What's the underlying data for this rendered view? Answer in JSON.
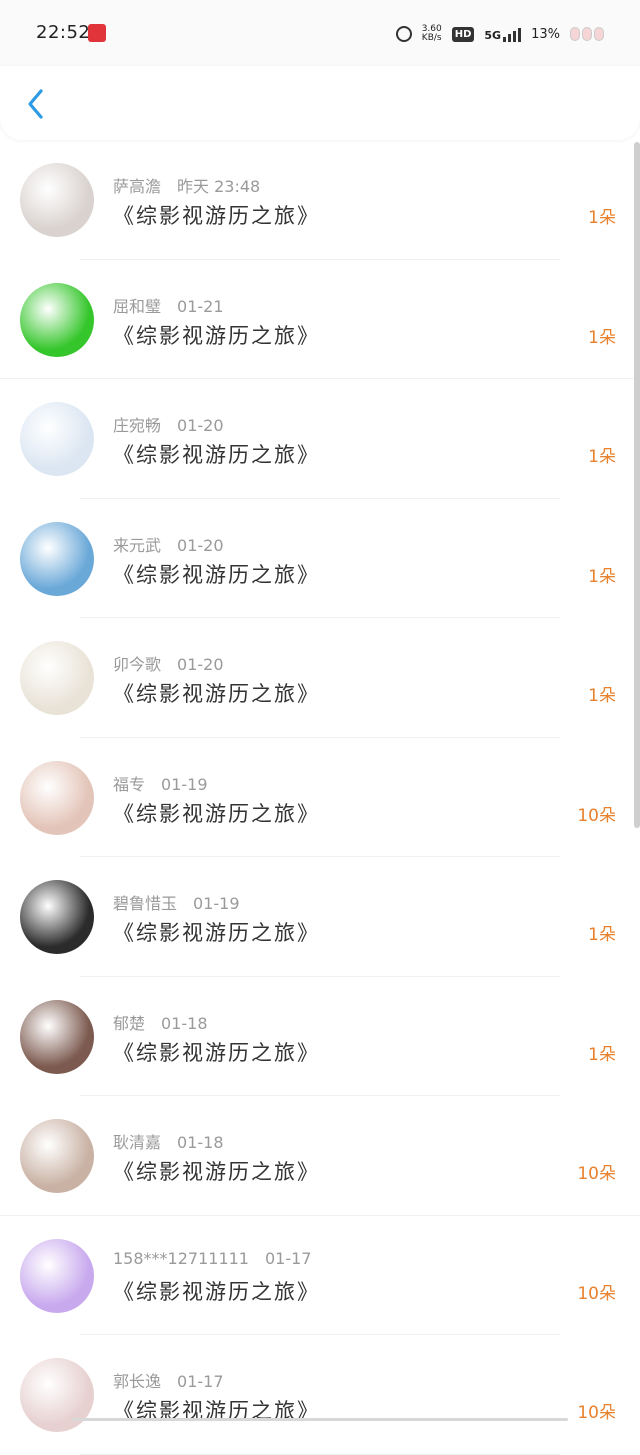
{
  "status_bar": {
    "time": "22:52",
    "net_speed_value": "3.60",
    "net_speed_unit": "KB/s",
    "hd": "HD",
    "network": "5G",
    "battery": "13%"
  },
  "nav": {
    "back_icon": "chevron-left-icon"
  },
  "records": [
    {
      "name": "萨高澹",
      "date": "昨天 23:48",
      "title": "《综影视游历之旅》",
      "amount": "1朵",
      "avatar_color": "#d9d2cf"
    },
    {
      "name": "屈和璧",
      "date": "01-21",
      "title": "《综影视游历之旅》",
      "amount": "1朵",
      "avatar_color": "#35c62b"
    },
    {
      "name": "庄宛畅",
      "date": "01-20",
      "title": "《综影视游历之旅》",
      "amount": "1朵",
      "avatar_color": "#dbe6f2"
    },
    {
      "name": "来元武",
      "date": "01-20",
      "title": "《综影视游历之旅》",
      "amount": "1朵",
      "avatar_color": "#6aa8d8"
    },
    {
      "name": "卯今歌",
      "date": "01-20",
      "title": "《综影视游历之旅》",
      "amount": "1朵",
      "avatar_color": "#e9e3d7"
    },
    {
      "name": "福专",
      "date": "01-19",
      "title": "《综影视游历之旅》",
      "amount": "10朵",
      "avatar_color": "#e3c4b8"
    },
    {
      "name": "碧鲁惜玉",
      "date": "01-19",
      "title": "《综影视游历之旅》",
      "amount": "1朵",
      "avatar_color": "#2b2b2b"
    },
    {
      "name": "郁楚",
      "date": "01-18",
      "title": "《综影视游历之旅》",
      "amount": "1朵",
      "avatar_color": "#7c5a4f"
    },
    {
      "name": "耿清嘉",
      "date": "01-18",
      "title": "《综影视游历之旅》",
      "amount": "10朵",
      "avatar_color": "#c9b2a4"
    },
    {
      "name": "158***12711111",
      "date": "01-17",
      "title": "《综影视游历之旅》",
      "amount": "10朵",
      "avatar_color": "#c8a9ee"
    },
    {
      "name": "郭长逸",
      "date": "01-17",
      "title": "《综影视游历之旅》",
      "amount": "10朵",
      "avatar_color": "#e7d0d0"
    }
  ],
  "colors": {
    "accent": "#e8812e",
    "back_arrow": "#2b9be6"
  }
}
